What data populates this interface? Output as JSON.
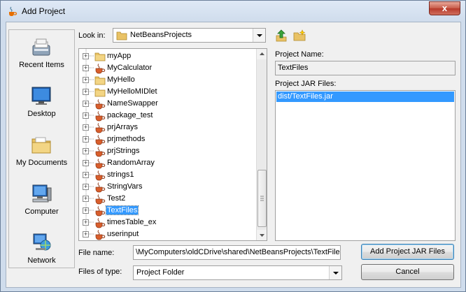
{
  "window": {
    "title": "Add Project",
    "close_glyph": "x"
  },
  "places": [
    {
      "label": "Recent Items",
      "icon": "recent-items-icon"
    },
    {
      "label": "Desktop",
      "icon": "desktop-icon"
    },
    {
      "label": "My Documents",
      "icon": "my-documents-icon"
    },
    {
      "label": "Computer",
      "icon": "computer-icon"
    },
    {
      "label": "Network",
      "icon": "network-icon"
    }
  ],
  "look_in": {
    "label": "Look in:",
    "value": "NetBeansProjects",
    "icon": "folder-icon"
  },
  "toolbar": {
    "up_icon": "up-folder-icon",
    "new_folder_icon": "new-folder-icon"
  },
  "tree": {
    "items": [
      {
        "label": "myApp",
        "icon": "folder-icon"
      },
      {
        "label": "MyCalculator",
        "icon": "java-project-icon"
      },
      {
        "label": "MyHello",
        "icon": "folder-icon"
      },
      {
        "label": "MyHelloMIDlet",
        "icon": "folder-icon"
      },
      {
        "label": "NameSwapper",
        "icon": "java-project-icon"
      },
      {
        "label": "package_test",
        "icon": "java-project-icon"
      },
      {
        "label": "prjArrays",
        "icon": "java-project-icon"
      },
      {
        "label": "prjmethods",
        "icon": "java-project-icon"
      },
      {
        "label": "prjStrings",
        "icon": "java-project-icon"
      },
      {
        "label": "RandomArray",
        "icon": "java-project-icon"
      },
      {
        "label": "strings1",
        "icon": "java-project-icon"
      },
      {
        "label": "StringVars",
        "icon": "java-project-icon"
      },
      {
        "label": "Test2",
        "icon": "java-project-icon"
      },
      {
        "label": "TextFiles",
        "icon": "java-project-icon",
        "selected": true
      },
      {
        "label": "timesTable_ex",
        "icon": "java-project-icon"
      },
      {
        "label": "userinput",
        "icon": "java-project-icon"
      }
    ]
  },
  "project_name": {
    "label": "Project Name:",
    "value": "TextFiles"
  },
  "project_jars": {
    "label": "Project JAR Files:",
    "items": [
      "dist/TextFiles.jar"
    ]
  },
  "file_name": {
    "label": "File name:",
    "value": "\\MyComputers\\oldCDrive\\shared\\NetBeansProjects\\TextFiles"
  },
  "files_of_type": {
    "label": "Files of type:",
    "value": "Project Folder"
  },
  "buttons": {
    "add": "Add Project JAR Files",
    "cancel": "Cancel"
  },
  "colors": {
    "selection": "#3399ff",
    "window_frame": "#cfdcec"
  }
}
